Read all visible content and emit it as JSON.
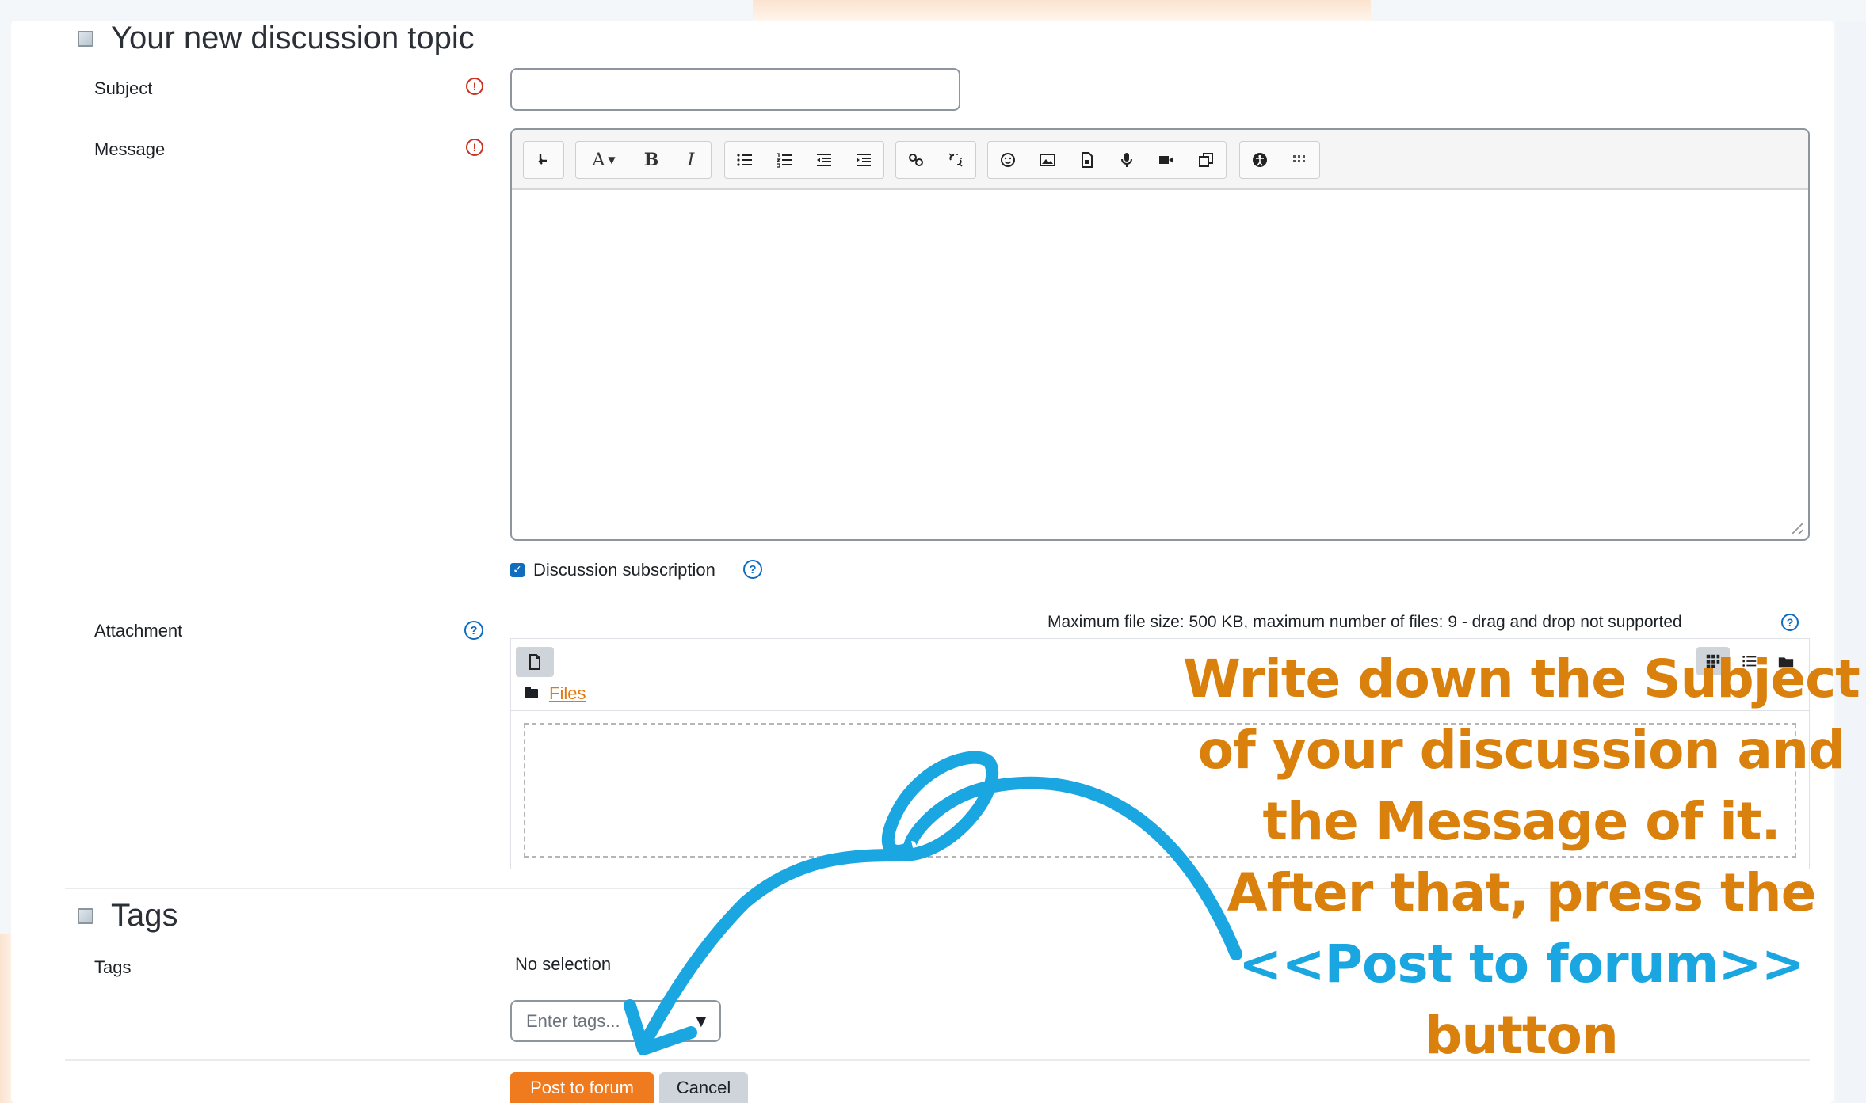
{
  "sections": {
    "topic_title": "Your new discussion topic",
    "tags_title": "Tags"
  },
  "fields": {
    "subject_label": "Subject",
    "message_label": "Message",
    "attachment_label": "Attachment",
    "tags_label": "Tags",
    "required_symbol": "!",
    "help_symbol": "?",
    "subject_value": "",
    "message_value": ""
  },
  "editor": {
    "toolbar_groups": [
      [
        "undo-icon"
      ],
      [
        "font-size-icon",
        "bold-icon",
        "italic-icon"
      ],
      [
        "bullet-list-icon",
        "numbered-list-icon",
        "outdent-icon",
        "indent-icon"
      ],
      [
        "link-icon",
        "unlink-icon"
      ],
      [
        "emoji-icon",
        "image-icon",
        "media-icon",
        "record-audio-icon",
        "record-video-icon",
        "copy-icon"
      ],
      [
        "accessibility-icon",
        "more-icon"
      ]
    ],
    "font_label": "A",
    "bold_label": "B",
    "italic_label": "I"
  },
  "subscription": {
    "label": "Discussion subscription",
    "checked": true
  },
  "attachment": {
    "limits_text": "Maximum file size: 500 KB, maximum number of files: 9 - drag and drop not supported",
    "files_link": "Files"
  },
  "tags": {
    "no_selection": "No selection",
    "placeholder": "Enter tags...",
    "dropdown_glyph": "▼"
  },
  "actions": {
    "post_label": "Post to forum",
    "cancel_label": "Cancel"
  },
  "annotation": {
    "line1_pre": "Write down the ",
    "line1_bold": "Subject",
    "line2": "of your discussion and",
    "line3_pre": "the ",
    "line3_bold": "Message",
    "line3_post": " of it.",
    "line4": "After that, press the",
    "line5": "<<Post to forum>>",
    "line6": "button"
  },
  "colors": {
    "accent_orange": "#f07a1e",
    "annotation_orange": "#d9810c",
    "annotation_blue": "#1aa6e0",
    "required_red": "#ca3120",
    "help_blue": "#0f6cbf"
  }
}
